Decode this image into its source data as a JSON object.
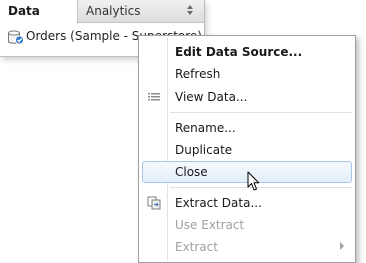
{
  "pane": {
    "tabs": [
      {
        "label": "Data"
      },
      {
        "label": "Analytics"
      }
    ],
    "datasource": {
      "label": "Orders (Sample - Superstore)"
    }
  },
  "context_menu": {
    "items": [
      {
        "label": "Edit Data Source...",
        "bold": true
      },
      {
        "label": "Refresh"
      },
      {
        "label": "View Data...",
        "icon": "view-data-icon"
      },
      {
        "label": "Rename..."
      },
      {
        "label": "Duplicate"
      },
      {
        "label": "Close",
        "highlighted": true
      },
      {
        "label": "Extract Data...",
        "icon": "extract-icon"
      },
      {
        "label": "Use Extract",
        "disabled": true
      },
      {
        "label": "Extract",
        "disabled": true,
        "submenu": true
      }
    ]
  },
  "colors": {
    "hover_fill": "#e4eefa",
    "hover_border": "#a8c6ea",
    "disabled_text": "#a0a0a0"
  }
}
